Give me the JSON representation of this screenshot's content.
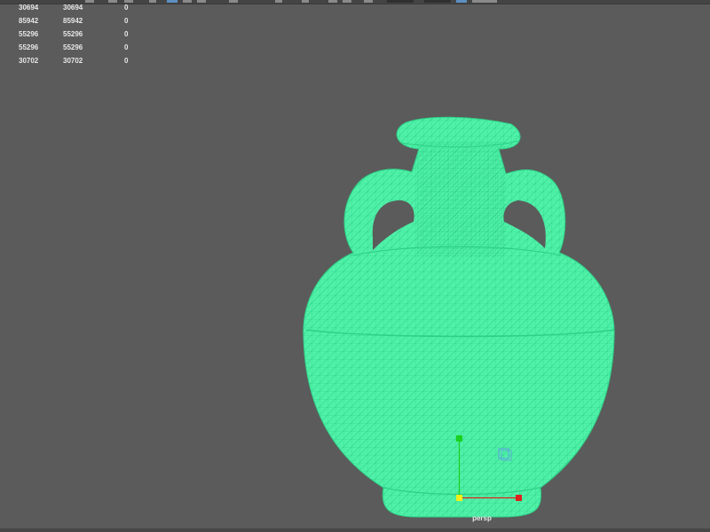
{
  "viewport": {
    "camera_label": "persp",
    "mesh_color": "#4ff0a8",
    "wire_color": "#2fcf86",
    "background": "#5b5b5b"
  },
  "hud": {
    "rows": [
      [
        "30694",
        "30694",
        "0"
      ],
      [
        "85942",
        "85942",
        "0"
      ],
      [
        "55296",
        "55296",
        "0"
      ],
      [
        "55296",
        "55296",
        "0"
      ],
      [
        "30702",
        "30702",
        "0"
      ]
    ]
  },
  "icons": {
    "axis_y": "green-axis-handle-icon",
    "axis_x": "red-axis-handle-icon",
    "origin": "yellow-origin-handle-icon",
    "view_cube": "view-cube-icon"
  },
  "colors": {
    "axis_x": "#e0201c",
    "axis_y": "#19d21f",
    "origin": "#f2ef19",
    "view_cube": "#5ea0e0"
  }
}
